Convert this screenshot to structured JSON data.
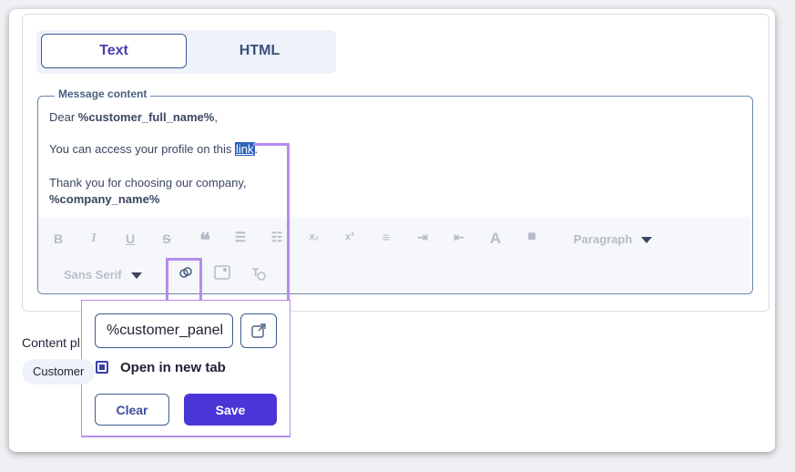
{
  "tabs": {
    "text": "Text",
    "html": "HTML"
  },
  "editor": {
    "legend": "Message content",
    "greeting_prefix": "Dear ",
    "greeting_var": "%customer_full_name%",
    "greeting_suffix": ",",
    "access_prefix": "You can access your profile on this ",
    "access_link": "link",
    "access_suffix": ".",
    "thanks": "Thank you for choosing our company,",
    "company_var": "%company_name%"
  },
  "toolbar": {
    "paragraph": "Paragraph",
    "font": "Sans Serif"
  },
  "link_popup": {
    "url_value": "%customer_panel",
    "open_new_tab_label": "Open in new tab",
    "open_new_tab_checked": true,
    "clear_label": "Clear",
    "save_label": "Save"
  },
  "placeholders": {
    "label": "Content pl",
    "chip": "Customer"
  },
  "colors": {
    "accent": "#4a36d6",
    "highlight": "#b58cf0",
    "link_bg": "#2e62b8"
  }
}
